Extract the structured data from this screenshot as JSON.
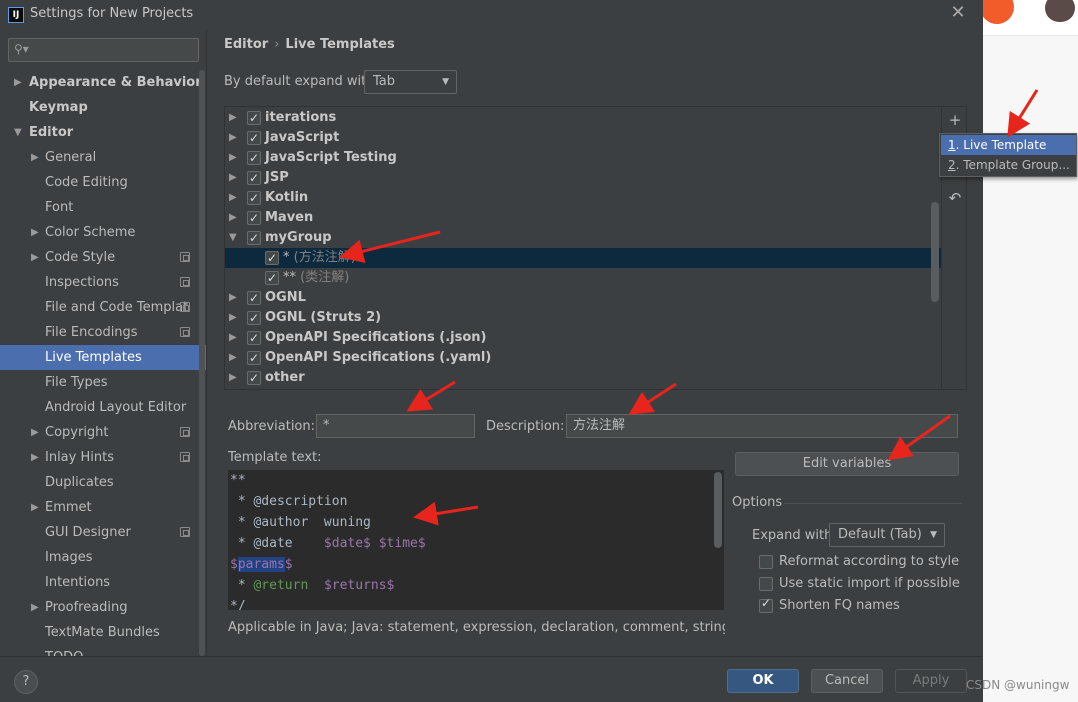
{
  "window": {
    "title": "Settings for New Projects",
    "app_icon": "IJ"
  },
  "sidebar": {
    "search_placeholder": "",
    "items": [
      {
        "label": "Appearance & Behavior",
        "level": 0,
        "arrow": "▶",
        "bold": true
      },
      {
        "label": "Keymap",
        "level": 0,
        "arrow": "",
        "bold": true
      },
      {
        "label": "Editor",
        "level": 0,
        "arrow": "▼",
        "bold": true
      },
      {
        "label": "General",
        "level": 1,
        "arrow": "▶"
      },
      {
        "label": "Code Editing",
        "level": 1,
        "arrow": ""
      },
      {
        "label": "Font",
        "level": 1,
        "arrow": ""
      },
      {
        "label": "Color Scheme",
        "level": 1,
        "arrow": "▶"
      },
      {
        "label": "Code Style",
        "level": 1,
        "arrow": "▶",
        "scope": true
      },
      {
        "label": "Inspections",
        "level": 1,
        "arrow": "",
        "scope": true
      },
      {
        "label": "File and Code Templat",
        "level": 1,
        "arrow": "",
        "scope": true
      },
      {
        "label": "File Encodings",
        "level": 1,
        "arrow": "",
        "scope": true
      },
      {
        "label": "Live Templates",
        "level": 1,
        "arrow": "",
        "selected": true
      },
      {
        "label": "File Types",
        "level": 1,
        "arrow": ""
      },
      {
        "label": "Android Layout Editor",
        "level": 1,
        "arrow": ""
      },
      {
        "label": "Copyright",
        "level": 1,
        "arrow": "▶",
        "scope": true
      },
      {
        "label": "Inlay Hints",
        "level": 1,
        "arrow": "▶",
        "scope": true
      },
      {
        "label": "Duplicates",
        "level": 1,
        "arrow": ""
      },
      {
        "label": "Emmet",
        "level": 1,
        "arrow": "▶"
      },
      {
        "label": "GUI Designer",
        "level": 1,
        "arrow": "",
        "scope": true
      },
      {
        "label": "Images",
        "level": 1,
        "arrow": ""
      },
      {
        "label": "Intentions",
        "level": 1,
        "arrow": ""
      },
      {
        "label": "Proofreading",
        "level": 1,
        "arrow": "▶"
      },
      {
        "label": "TextMate Bundles",
        "level": 1,
        "arrow": ""
      },
      {
        "label": "TODO",
        "level": 1,
        "arrow": ""
      }
    ]
  },
  "breadcrumb": {
    "parent": "Editor",
    "separator": "›",
    "current": "Live Templates"
  },
  "expand": {
    "label": "By default expand with",
    "value": "Tab"
  },
  "templates": [
    {
      "name": "iterations",
      "group": true,
      "expanded": false,
      "checked": true
    },
    {
      "name": "JavaScript",
      "group": true,
      "expanded": false,
      "checked": true
    },
    {
      "name": "JavaScript Testing",
      "group": true,
      "expanded": false,
      "checked": true
    },
    {
      "name": "JSP",
      "group": true,
      "expanded": false,
      "checked": true
    },
    {
      "name": "Kotlin",
      "group": true,
      "expanded": false,
      "checked": true
    },
    {
      "name": "Maven",
      "group": true,
      "expanded": false,
      "checked": true
    },
    {
      "name": "myGroup",
      "group": true,
      "expanded": true,
      "checked": true
    },
    {
      "name": "*",
      "desc": "(方法注解)",
      "group": false,
      "checked": true,
      "selected": true
    },
    {
      "name": "**",
      "desc": "(类注解)",
      "group": false,
      "checked": true
    },
    {
      "name": "OGNL",
      "group": true,
      "expanded": false,
      "checked": true
    },
    {
      "name": "OGNL (Struts 2)",
      "group": true,
      "expanded": false,
      "checked": true
    },
    {
      "name": "OpenAPI Specifications (.json)",
      "group": true,
      "expanded": false,
      "checked": true
    },
    {
      "name": "OpenAPI Specifications (.yaml)",
      "group": true,
      "expanded": false,
      "checked": true
    },
    {
      "name": "other",
      "group": true,
      "expanded": false,
      "checked": true
    }
  ],
  "toolbar": {
    "add": "+",
    "revert": "↶"
  },
  "popup_menu": {
    "items": [
      {
        "mnemonic": "1",
        "label": ". Live Template",
        "selected": true
      },
      {
        "mnemonic": "2",
        "label": ". Template Group..."
      }
    ]
  },
  "fields": {
    "abbreviation_label": "Abbreviation:",
    "abbreviation_value": "*",
    "description_label": "Description:",
    "description_value": "方法注解",
    "template_text_label": "Template text:"
  },
  "template_text": {
    "l1": "**",
    "l2": " * @description",
    "l3a": " * @author  wuning",
    "l4a": " * @date    ",
    "l4b": "$date$",
    "l4c": " ",
    "l4d": "$time$",
    "l5a": "$",
    "l5b": "params",
    "l5c": "$",
    "l6a": " * ",
    "l6b": "@return",
    "l6c": "  ",
    "l6d": "$returns$",
    "l7": "*/"
  },
  "edit_variables_label": "Edit variables",
  "options": {
    "title": "Options",
    "expand_with_label": "Expand with",
    "expand_with_value": "Default (Tab)",
    "reformat_label": "Reformat according to style",
    "reformat_checked": false,
    "static_import_label": "Use static import if possible",
    "static_import_checked": false,
    "shorten_label": "Shorten FQ names",
    "shorten_checked": true
  },
  "applicable_text": "Applicable in Java; Java: statement, expression, declaration, comment, string, smart ty",
  "buttons": {
    "help": "?",
    "ok": "OK",
    "cancel": "Cancel",
    "apply": "Apply"
  },
  "watermark": "CSDN @wuningw",
  "colors": {
    "background": "#3c3f41",
    "selection": "#4b6eaf",
    "tree_selection": "#0d293e",
    "annotation_arrow": "#e8251c",
    "editor_bg": "#2b2b2b"
  },
  "icons": [
    "search-icon",
    "close-icon",
    "add-icon",
    "revert-icon",
    "help-icon",
    "chevron-down-icon",
    "scope-icon"
  ]
}
